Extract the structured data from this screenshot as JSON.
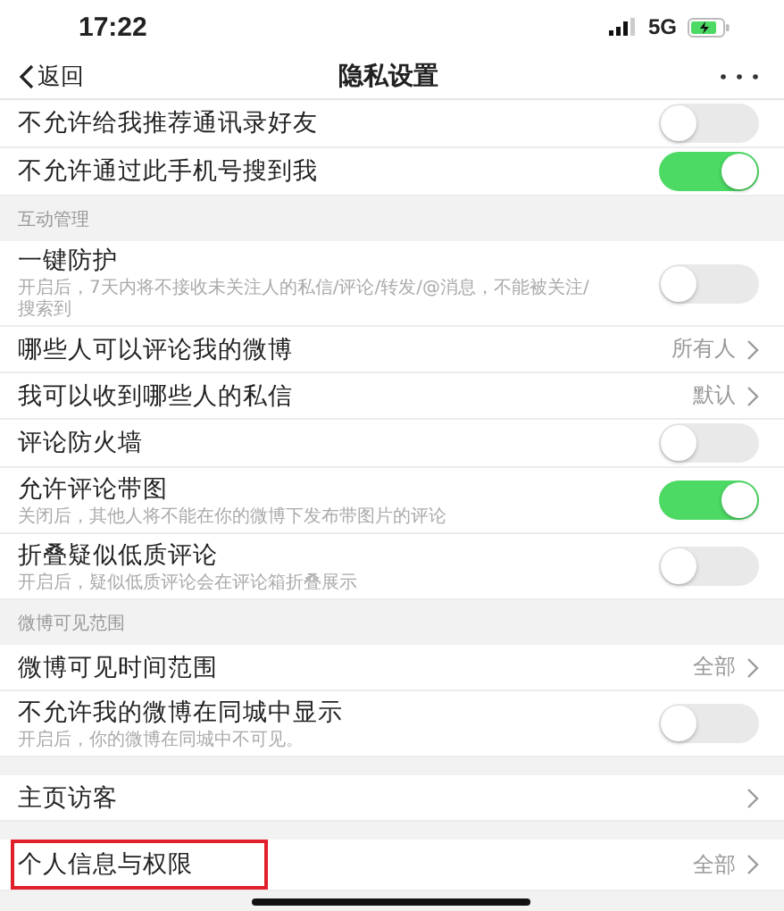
{
  "status_bar": {
    "time": "17:22",
    "network": "5G"
  },
  "nav": {
    "back": "返回",
    "title": "隐私设置"
  },
  "items": [
    {
      "kind": "toggle",
      "label": "不允许给我推荐通讯录好友",
      "on": false
    },
    {
      "kind": "toggle",
      "label": "不允许通过此手机号搜到我",
      "on": true
    },
    {
      "kind": "header",
      "label": "互动管理"
    },
    {
      "kind": "toggle",
      "label": "一键防护",
      "description": "开启后，7天内将不接收未关注人的私信/评论/转发/@消息，不能被关注/搜索到",
      "on": false
    },
    {
      "kind": "link",
      "label": "哪些人可以评论我的微博",
      "value": "所有人",
      "highlighted": false
    },
    {
      "kind": "link",
      "label": "我可以收到哪些人的私信",
      "value": "默认",
      "highlighted": false
    },
    {
      "kind": "toggle",
      "label": "评论防火墙",
      "on": false
    },
    {
      "kind": "toggle",
      "label": "允许评论带图",
      "description": "关闭后，其他人将不能在你的微博下发布带图片的评论",
      "on": true
    },
    {
      "kind": "toggle",
      "label": "折叠疑似低质评论",
      "description": "开启后，疑似低质评论会在评论箱折叠展示",
      "on": false
    },
    {
      "kind": "header",
      "label": "微博可见范围"
    },
    {
      "kind": "link",
      "label": "微博可见时间范围",
      "value": "全部",
      "highlighted": false
    },
    {
      "kind": "toggle",
      "label": "不允许我的微博在同城中显示",
      "description": "开启后，你的微博在同城中不可见。",
      "on": false
    },
    {
      "kind": "gap"
    },
    {
      "kind": "link",
      "label": "主页访客",
      "highlighted": false
    },
    {
      "kind": "gap"
    },
    {
      "kind": "link",
      "label": "个人信息与权限",
      "value": "全部",
      "highlighted": true
    }
  ]
}
